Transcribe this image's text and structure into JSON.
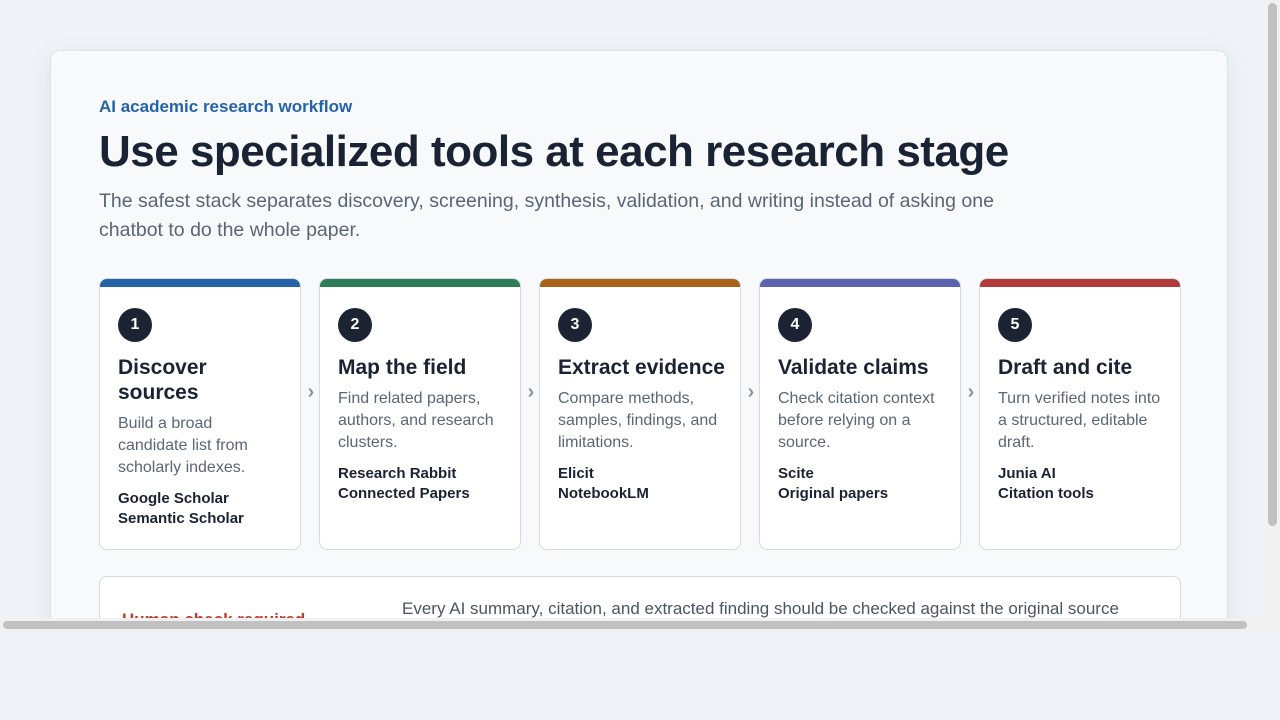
{
  "header": {
    "eyebrow": "AI academic research workflow",
    "title": "Use specialized tools at each research stage",
    "subtitle": "The safest stack separates discovery, screening, synthesis, validation, and writing instead of asking one chatbot to do the whole paper."
  },
  "steps": [
    {
      "number": "1",
      "title": "Discover sources",
      "description": "Build a broad candidate list from scholarly indexes.",
      "tools": [
        "Google Scholar",
        "Semantic Scholar"
      ],
      "color": "#2563a8"
    },
    {
      "number": "2",
      "title": "Map the field",
      "description": "Find related papers, authors, and research clusters.",
      "tools": [
        "Research Rabbit",
        "Connected Papers"
      ],
      "color": "#2e7d57"
    },
    {
      "number": "3",
      "title": "Extract evidence",
      "description": "Compare methods, samples, findings, and limitations.",
      "tools": [
        "Elicit",
        "NotebookLM"
      ],
      "color": "#a8621b"
    },
    {
      "number": "4",
      "title": "Validate claims",
      "description": "Check citation context before relying on a source.",
      "tools": [
        "Scite",
        "Original papers"
      ],
      "color": "#5b63b0"
    },
    {
      "number": "5",
      "title": "Draft and cite",
      "description": "Turn verified notes into a structured, editable draft.",
      "tools": [
        "Junia AI",
        "Citation tools"
      ],
      "color": "#b03a3a"
    }
  ],
  "chevron_glyph": "›",
  "notice": {
    "label": "Human check required",
    "text": "Every AI summary, citation, and extracted finding should be checked against the original source"
  }
}
